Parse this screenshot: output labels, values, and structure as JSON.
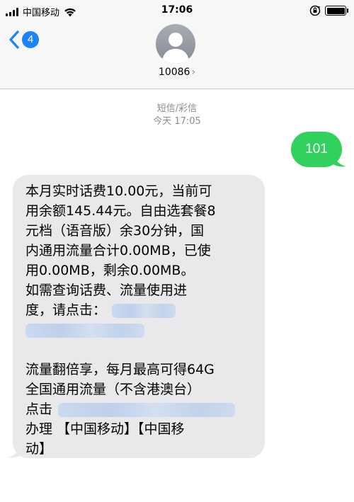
{
  "status_bar": {
    "carrier": "中国移动",
    "time": "17:06",
    "signal_bars": 4,
    "battery_level": 1.0
  },
  "header": {
    "back_count": "4",
    "contact_name": "10086",
    "contact_chevron": "›",
    "avatar_icon": "person-silhouette"
  },
  "conversation": {
    "message_type": "短信/彩信",
    "timestamp": "今天 17:05",
    "outgoing": {
      "text": "101",
      "color": "#32d15d"
    },
    "incoming": {
      "lines": [
        "本月实时话费10.00元，当前可",
        "用余额145.44元。自由选套餐8",
        "元档（语音版）余30分钟，国",
        "内通用流量合计0.00MB，已使",
        "用0.00MB，剩余0.00MB。",
        "如需查询话费、流量使用进",
        "度，请点击：",
        "",
        "",
        "流量翻倍享，每月最高可得64G",
        "全国通用流量（不含港澳台）",
        "点击",
        "办理 【中国移动】【中国移",
        "动】"
      ]
    }
  },
  "colors": {
    "accent_blue": "#1a82fb",
    "incoming_bubble": "#e9e9eb",
    "meta_gray": "#8e8e93"
  }
}
